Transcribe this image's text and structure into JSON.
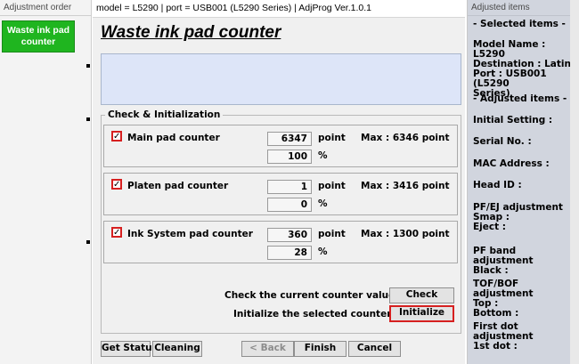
{
  "left_panel": {
    "title": "Adjustment order",
    "selected_item": "Waste ink pad\ncounter"
  },
  "main": {
    "window_title": "model = L5290 | port = USB001 (L5290 Series) | AdjProg Ver.1.0.1",
    "heading": "Waste ink pad counter",
    "message_area": "",
    "group_title": "Check & Initialization",
    "counters": [
      {
        "label": "Main pad counter",
        "checked": true,
        "value": "6347",
        "unit": "point",
        "max": "Max : 6346 point",
        "percent": "100",
        "percent_unit": "%"
      },
      {
        "label": "Platen pad counter",
        "checked": true,
        "value": "1",
        "unit": "point",
        "max": "Max : 3416 point",
        "percent": "0",
        "percent_unit": "%"
      },
      {
        "label": "Ink System pad counter",
        "checked": true,
        "value": "360",
        "unit": "point",
        "max": "Max : 1300 point",
        "percent": "28",
        "percent_unit": "%"
      }
    ],
    "check_hint": "Check the current counter value.  -->",
    "check_button": "Check",
    "init_hint": "Initialize the selected counters.  -->",
    "init_button": "Initialize",
    "buttons": {
      "get_status": "Get Status",
      "cleaning": "Cleaning",
      "back": "< Back",
      "finish": "Finish",
      "cancel": "Cancel"
    }
  },
  "right_panel": {
    "title": "Adjusted items",
    "items": [
      "- Selected items -",
      "Model Name : L5290\nDestination : Latin\nPort : USB001 (L5290\nSeries)",
      "- Adjusted items -",
      "Initial Setting :",
      "Serial No. :",
      "MAC Address :",
      "Head ID :",
      "PF/EJ adjustment\n  Smap :\n  Eject :",
      "PF band adjustment\n  Black :",
      "TOF/BOF adjustment\n  Top :\n  Bottom :",
      "First dot adjustment\n  1st dot :"
    ]
  },
  "colors": {
    "accent_green": "#1fb51f",
    "highlight_red": "#d62020",
    "message_bg": "#dde5f8",
    "right_panel_bg": "#d1d5de"
  },
  "icons": {
    "checkbox": "check-mark"
  }
}
